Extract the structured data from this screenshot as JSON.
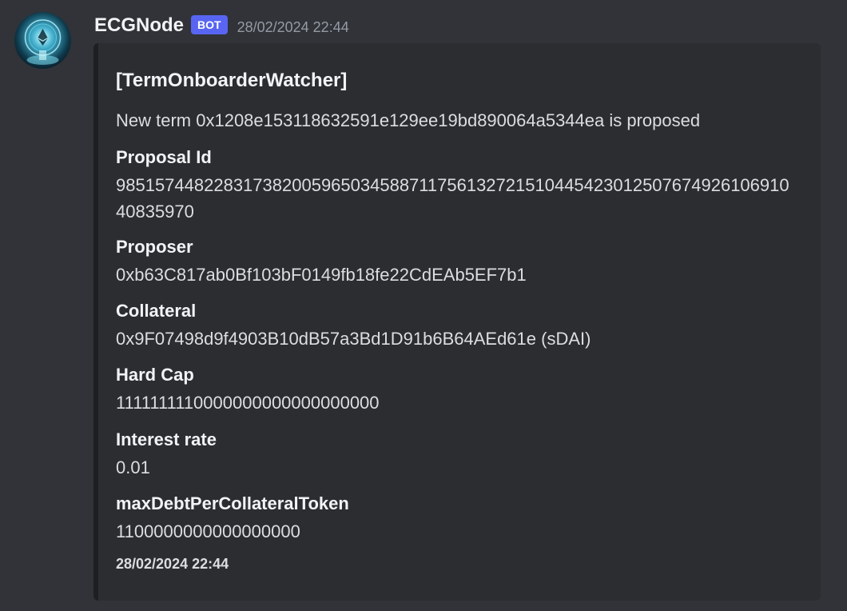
{
  "message": {
    "username": "ECGNode",
    "bot_tag": "BOT",
    "timestamp": "28/02/2024 22:44",
    "avatar_icon": "ethereum-orb-avatar"
  },
  "embed": {
    "title": "[TermOnboarderWatcher]",
    "description": "New term 0x1208e153118632591e129ee19bd890064a5344ea is proposed",
    "fields": [
      {
        "name": "Proposal Id",
        "value": "98515744822831738200596503458871175613272151044542301250767492610691040835970"
      },
      {
        "name": "Proposer",
        "value": "0xb63C817ab0Bf103bF0149fb18fe22CdEAb5EF7b1"
      },
      {
        "name": "Collateral",
        "value": "0x9F07498d9f4903B10dB57a3Bd1D91b6B64AEd61e (sDAI)"
      },
      {
        "name": "Hard Cap",
        "value": "1111111110000000000000000000"
      },
      {
        "name": "Interest rate",
        "value": "0.01"
      },
      {
        "name": "maxDebtPerCollateralToken",
        "value": "1100000000000000000"
      }
    ],
    "footer": "28/02/2024 22:44",
    "colors": {
      "background": "#313338",
      "embed_background": "#2b2d31",
      "bot_tag": "#5865f2"
    }
  }
}
